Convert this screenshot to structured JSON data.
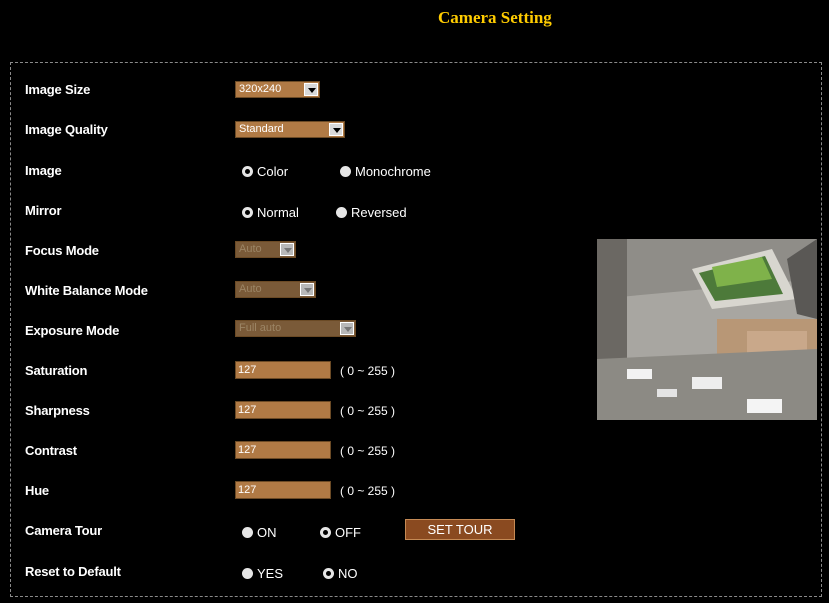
{
  "title": "Camera Setting",
  "image_size": {
    "label": "Image Size",
    "value": "320x240"
  },
  "image_quality": {
    "label": "Image Quality",
    "value": "Standard"
  },
  "image": {
    "label": "Image",
    "options": [
      "Color",
      "Monochrome"
    ],
    "selected": "Color"
  },
  "mirror": {
    "label": "Mirror",
    "options": [
      "Normal",
      "Reversed"
    ],
    "selected": "Normal"
  },
  "focus_mode": {
    "label": "Focus Mode",
    "value": "Auto"
  },
  "white_balance": {
    "label": "White Balance Mode",
    "value": "Auto"
  },
  "exposure_mode": {
    "label": "Exposure Mode",
    "value": "Full auto"
  },
  "saturation": {
    "label": "Saturation",
    "value": "127",
    "range": "( 0 ~ 255 )"
  },
  "sharpness": {
    "label": "Sharpness",
    "value": "127",
    "range": "( 0 ~ 255 )"
  },
  "contrast": {
    "label": "Contrast",
    "value": "127",
    "range": "( 0 ~ 255 )"
  },
  "hue": {
    "label": "Hue",
    "value": "127",
    "range": "( 0 ~ 255 )"
  },
  "camera_tour": {
    "label": "Camera Tour",
    "options": [
      "ON",
      "OFF"
    ],
    "selected": "OFF",
    "button": "SET TOUR"
  },
  "reset": {
    "label": "Reset to Default",
    "options": [
      "YES",
      "NO"
    ],
    "selected": "NO"
  },
  "colors": {
    "title": "#ffcc00",
    "field": "#b07a45",
    "button": "#8a4a20"
  }
}
